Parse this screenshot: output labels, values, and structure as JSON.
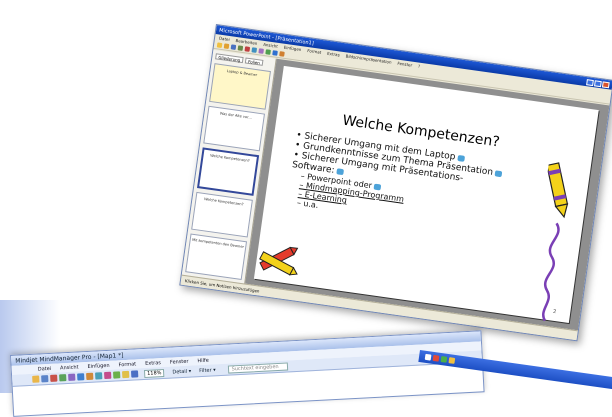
{
  "ppt": {
    "title": "Microsoft PowerPoint - [Präsentation1]",
    "menu": [
      "Datei",
      "Bearbeiten",
      "Ansicht",
      "Einfügen",
      "Format",
      "Extras",
      "Bildschirmpräsentation",
      "Fenster",
      "?"
    ],
    "side_tabs": [
      "Gliederung",
      "Folien"
    ],
    "thumbnails": [
      {
        "text": "Laptop & Beamer"
      },
      {
        "text": "Was der Alte vor…"
      },
      {
        "text": "Welche Kompetenzen?"
      },
      {
        "text": "Welche Kompetenzen?"
      },
      {
        "text": "Mit kompetenten den Beamer"
      }
    ],
    "slide": {
      "title": "Welche Kompetenzen?",
      "bullets": [
        "• Sicherer Umgang mit dem Laptop",
        "• Grundkenntnisse zum Thema Präsentation",
        "• Sicherer Umgang mit Präsentations-",
        "  Software:"
      ],
      "subbullets": [
        "– Powerpoint oder",
        "– Mindmapping-Programm",
        "– E-Learning",
        "– u.a."
      ],
      "page": "2"
    },
    "status": "Klicken Sie, um Notizen hinzuzufügen"
  },
  "mindjet": {
    "title": "Mindjet MindManager Pro - [Map1 *]",
    "menu": [
      "Datei",
      "Ansicht",
      "Einfügen",
      "Format",
      "Extras",
      "Fenster",
      "Hilfe"
    ],
    "zoom": "118%",
    "detail_label": "Detail ▾",
    "filter_label": "Filter ▾",
    "search_placeholder": "Suchtext eingeben"
  },
  "colors": {
    "xp_blue": "#1d58d6",
    "slide_bg": "#ffffff",
    "canvas_gray": "#8f8f8f",
    "check_icon": "#4da3d9"
  }
}
